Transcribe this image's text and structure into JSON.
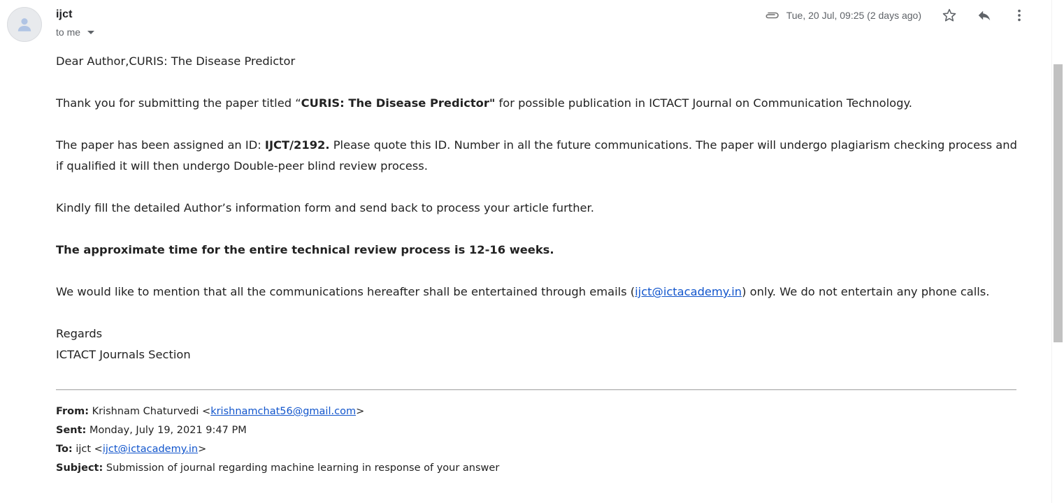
{
  "header": {
    "sender": "ijct",
    "to_label": "to me",
    "date": "Tue, 20 Jul, 09:25 (2 days ago)",
    "icons": [
      "attachment-icon",
      "star-icon",
      "reply-icon",
      "more-vert-icon"
    ]
  },
  "body": {
    "greeting": "Dear Author,CURIS: The Disease Predictor",
    "p1_pre": "Thank you for submitting the paper titled “",
    "p1_bold": "CURIS: The Disease Predictor\"",
    "p1_post": " for possible publication in ICTACT Journal on Communication Technology.",
    "p2_pre": "The paper has been assigned an ID: ",
    "p2_bold": "IJCT/2192.",
    "p2_post": "  Please quote this ID. Number in all the future communications. The paper will undergo plagiarism checking process and if qualified it will then undergo Double-peer blind review process.",
    "p3": "Kindly fill the detailed Author’s information form and send back to process your article further.",
    "p4_bold": "The approximate time for the entire technical review process is 12-16 weeks.",
    "p5_pre": "We would like to mention that all the communications hereafter shall be entertained through emails (",
    "p5_link": "ijct@ictacademy.in",
    "p5_post": ") only. We do not entertain any phone calls.",
    "regards": "Regards",
    "signature": "ICTACT Journals Section"
  },
  "original": {
    "from_label": "From:",
    "from_name": " Krishnam Chaturvedi <",
    "from_email": "krishnamchat56@gmail.com",
    "from_close": ">",
    "sent_label": "Sent:",
    "sent_value": " Monday, July 19, 2021 9:47 PM",
    "to_label": "To:",
    "to_name": " ijct <",
    "to_email": "ijct@ictacademy.in",
    "to_close": ">",
    "subject_label": "Subject:",
    "subject_value": " Submission of journal regarding machine learning in response of your answer"
  },
  "colors": {
    "link": "#1155cc",
    "text": "#222222",
    "muted": "#5f6368"
  }
}
